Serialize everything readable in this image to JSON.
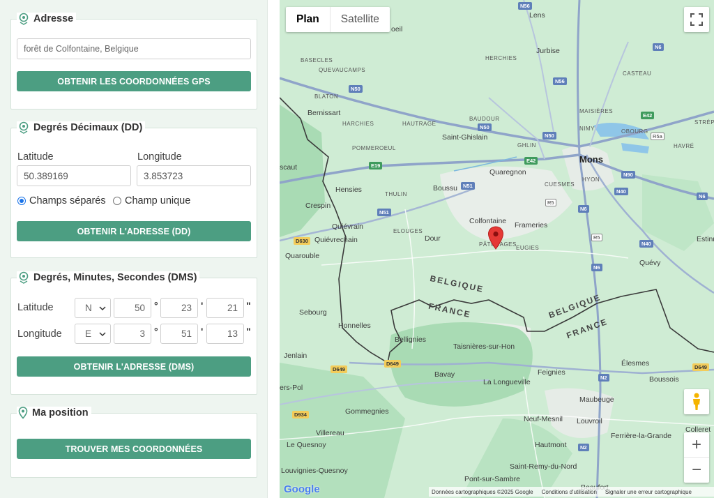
{
  "address": {
    "title": "Adresse",
    "value": "forêt de Colfontaine, Belgique",
    "button": "OBTENIR LES COORDONNÉES GPS"
  },
  "dd": {
    "title": "Degrés Décimaux (DD)",
    "lat_label": "Latitude",
    "lon_label": "Longitude",
    "lat_value": "50.389169",
    "lon_value": "3.853723",
    "radio_separate": "Champs séparés",
    "radio_single": "Champ unique",
    "button": "OBTENIR L'ADRESSE (DD)"
  },
  "dms": {
    "title": "Degrés, Minutes, Secondes (DMS)",
    "lat_label": "Latitude",
    "lon_label": "Longitude",
    "lat_dir": "N",
    "lat_deg": "50",
    "lat_min": "23",
    "lat_sec": "21",
    "lon_dir": "E",
    "lon_deg": "3",
    "lon_min": "51",
    "lon_sec": "13",
    "deg_symbol": "°",
    "min_symbol": "'",
    "sec_symbol": "\"",
    "button": "OBTENIR L'ADRESSE (DMS)"
  },
  "position": {
    "title": "Ma position",
    "button": "TROUVER MES COORDONNÉES"
  },
  "map": {
    "tab_plan": "Plan",
    "tab_satellite": "Satellite",
    "logo": "Google",
    "footer_data": "Données cartographiques ©2025 Google",
    "footer_terms": "Conditions d'utilisation",
    "footer_report": "Signaler une erreur cartographique",
    "zoom_in": "+",
    "zoom_out": "−",
    "labels": {
      "mons": "Mons",
      "lens": "Lens",
      "jurbise": "Jurbise",
      "herchies": "HERCHIES",
      "casteau": "CASTEAU",
      "basecles": "BASECLES",
      "quevaucamps": "QUEVAUCAMPS",
      "blaton": "BLATON",
      "bernissart": "Bernissart",
      "harchies": "HARCHIES",
      "hautrage": "HAUTRAGE",
      "baudour": "BAUDOUR",
      "maisieres": "MAISIÈRES",
      "nimy": "NIMY",
      "obourg": "OBOURG",
      "havre": "HAVRÉ",
      "strepy": "STRÉPY",
      "pommeroeul": "POMMEROEUL",
      "saint_ghislain": "Saint-Ghislain",
      "ghlin": "GHLIN",
      "quaregnon": "Quaregnon",
      "cuesmes": "CUESMES",
      "hyon": "HYON",
      "hensies": "Hensies",
      "thulin": "THULIN",
      "boussu": "Boussu",
      "crespin": "Crespin",
      "colfontaine": "Colfontaine",
      "frameries": "Frameries",
      "quievrain": "Quiévrain",
      "quievrechain": "Quiévrechain",
      "elouges": "ELOUGES",
      "dour": "Dour",
      "paturages": "PÂTURAGES",
      "eugies": "EUGIES",
      "estinnes": "Estinn",
      "quevy": "Quévy",
      "quarouble": "Quarouble",
      "scaut": "scaut",
      "belgique1": "BELGIQUE",
      "france1": "FRANCE",
      "belgique2": "BELGIQUE",
      "france2": "FRANCE",
      "sebourg": "Sebourg",
      "honnelles": "Honnelles",
      "bellignies": "Bellignies",
      "taisnieres": "Taisnières-sur-Hon",
      "jenlain": "Jenlain",
      "bavay": "Bavay",
      "la_longueville": "La Longueville",
      "feignies": "Feignies",
      "elesmes": "Élesmes",
      "boussois": "Boussois",
      "maubeuge": "Maubeuge",
      "sers_pol": "ers-Pol",
      "gommegnies": "Gommegnies",
      "neuf_mesnil": "Neuf-Mesnil",
      "louvroil": "Louvroil",
      "colleret": "Colleret",
      "villereau": "Villereau",
      "ferriere": "Ferrière-la-Grande",
      "le_quesnoy": "Le Quesnoy",
      "hautmont": "Hautmont",
      "saint_remy": "Saint-Remy-du-Nord",
      "louvignies": "Louvignies-Quesnoy",
      "pont_sur_sambre": "Pont-sur-Sambre",
      "beaufort": "Beaufort",
      "beloeil": "oeil"
    },
    "roads": {
      "n56a": "N56",
      "n56b": "N56",
      "n6a": "N6",
      "n6b": "N6",
      "n6c": "N6",
      "n50a": "N50",
      "n50b": "N50",
      "n50c": "N50",
      "e42a": "E42",
      "e42b": "E42",
      "e19": "E19",
      "n51a": "N51",
      "n51b": "N51",
      "r5": "R5",
      "r5b": "R5",
      "r5a": "R5a",
      "n90": "N90",
      "n40a": "N40",
      "n40b": "N40",
      "n6d": "N6",
      "d630": "D630",
      "d649a": "D649",
      "d649b": "D649",
      "d934": "D934",
      "n2a": "N2",
      "n2b": "N2",
      "e42c": "E42",
      "d649c": "D649"
    }
  }
}
